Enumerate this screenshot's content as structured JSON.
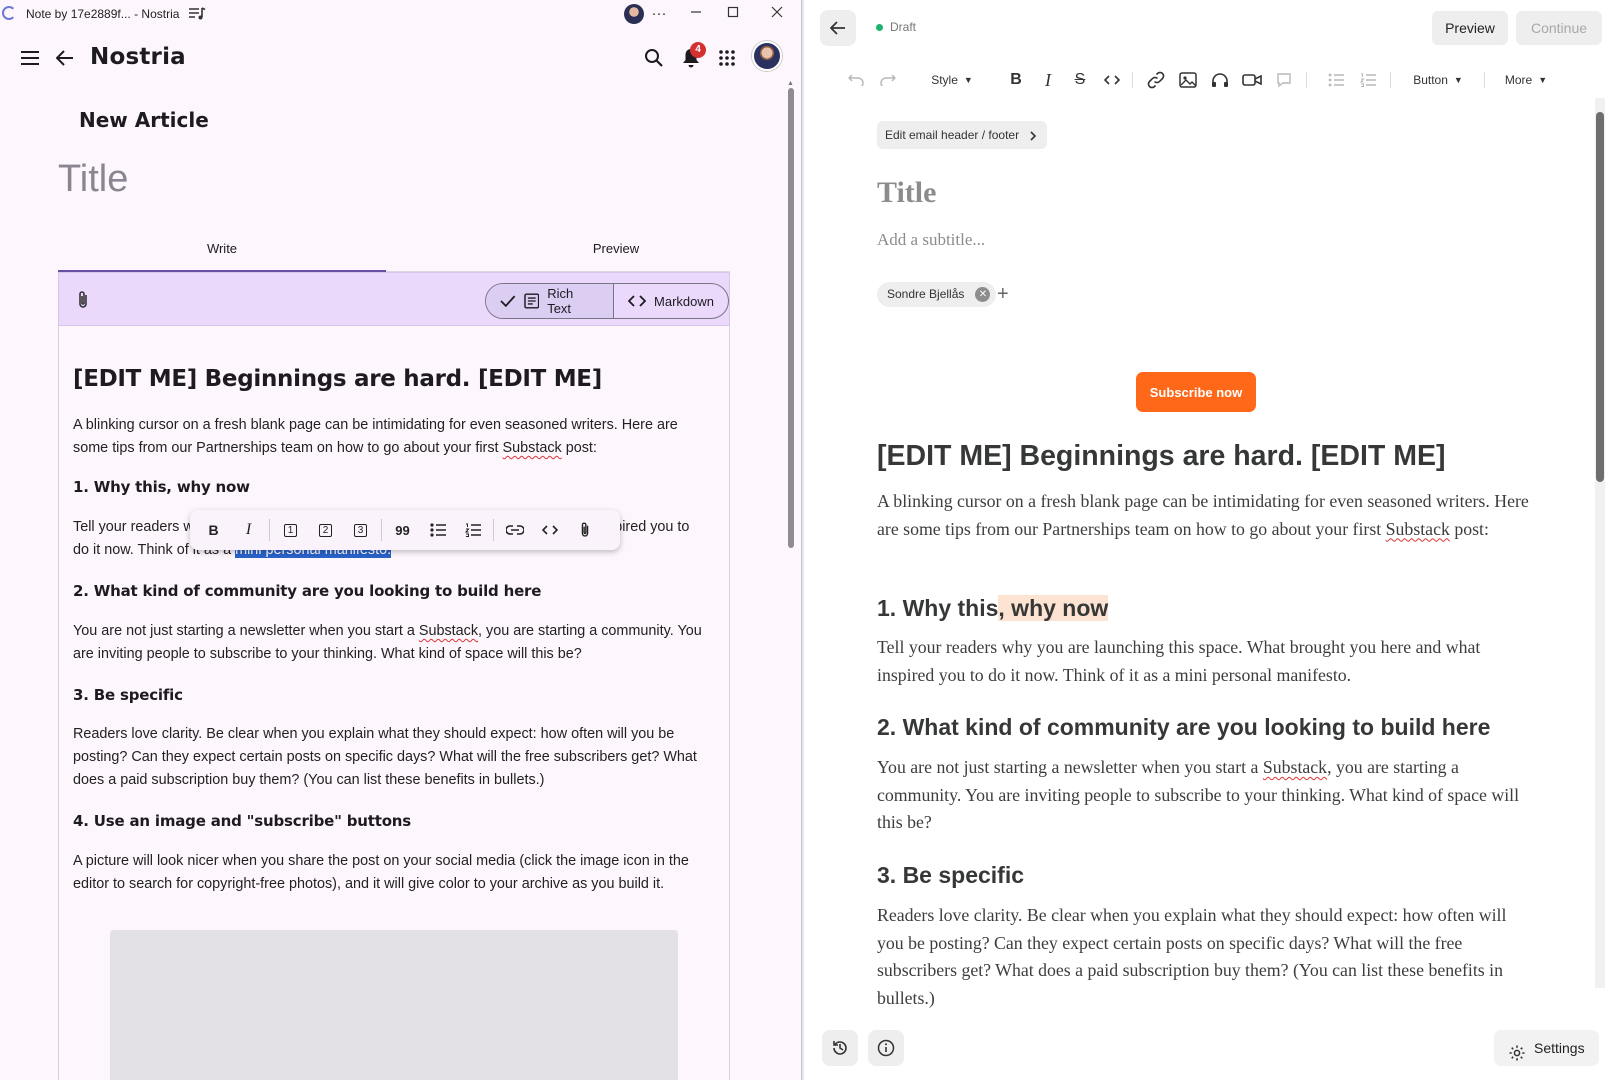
{
  "left_window": {
    "titlebar": {
      "title": "Note by 17e2889f... - Nostria"
    },
    "app": {
      "name": "Nostria",
      "notification_count": "4"
    },
    "page": {
      "heading": "New Article",
      "title_placeholder": "Title"
    },
    "tabs": [
      {
        "label": "Write",
        "active": true
      },
      {
        "label": "Preview",
        "active": false
      }
    ],
    "mode_toggle": {
      "rich_text": "Rich Text",
      "markdown": "Markdown",
      "selected": "Rich Text"
    },
    "article": {
      "h1": "[EDIT ME] Beginnings are hard. [EDIT ME]",
      "p1": "A blinking cursor on a fresh blank page can be intimidating for even seasoned writers. Here are some tips from our Partnerships team on how to go about your first ",
      "p1_word": "Substack",
      "p1_end": " post:",
      "h2_1": "1. Why this, why now",
      "p2_start": "Tell your readers w",
      "p2_end": "spired you to",
      "p2_line2": "do it now. Think of it as a ",
      "p2_selected": "mini personal manifesto.",
      "h2_2": "2. What kind of community are you looking to build here",
      "p3_a": "You are not just starting a newsletter when you start a ",
      "p3_word": "Substack",
      "p3_b": ", you are starting a community. You are inviting people to subscribe to your thinking. What kind of space will this be?",
      "h2_3": "3. Be specific",
      "p4": "Readers love clarity. Be clear when you explain what they should expect: how often will you be posting? Can they expect certain posts on specific days? What will the free subscribers get? What does a paid subscription buy them? (You can list these benefits in bullets.)",
      "h2_4": "4. Use an image and \"subscribe\" buttons",
      "p5": "A picture will look nicer when you share the post on your social media (click the image icon in the editor to search for copyright-free photos), and it will give color to your archive as you build it."
    },
    "floating_toolbar": {
      "h1": "1",
      "h2": "2",
      "h3": "3",
      "quote": "99"
    }
  },
  "right_window": {
    "status": "Draft",
    "buttons": {
      "preview": "Preview",
      "continue": "Continue",
      "settings": "Settings"
    },
    "toolbar": {
      "style": "Style",
      "button": "Button",
      "more": "More"
    },
    "edit_header_footer": "Edit email header / footer",
    "title_placeholder": "Title",
    "subtitle_placeholder": "Add a subtitle...",
    "author": "Sondre Bjellås",
    "subscribe_button": "Subscribe now",
    "article": {
      "h1": "[EDIT ME] Beginnings are hard. [EDIT ME]",
      "p1a": "A blinking cursor on a fresh blank page can be intimidating for even seasoned writers. Here are some tips from our Partnerships team on how to go about your first ",
      "p1_word": "Substack",
      "p1b": " post:",
      "h2_1a": "1. Why this",
      "h2_1b": ", why now",
      "p2": "Tell your readers why you are launching this space. What brought you here and what inspired you to do it now. Think of it as a mini personal manifesto.",
      "h2_2": "2. What kind of community are you looking to build here",
      "p3a": " You are not just starting a newsletter when you start a ",
      "p3_word": "Substack",
      "p3b": ", you are starting a community. You are inviting people to subscribe to your thinking. What kind of space will this be?",
      "h2_3": "3. Be specific",
      "p4": "Readers love clarity. Be clear when you explain what they should expect: how often will you be posting? Can they expect certain posts on specific days? What will the free subscribers get? What does a paid subscription buy them? (You can list these benefits in bullets.)"
    }
  },
  "colors": {
    "nostria_accent": "#6750a4",
    "substack_orange": "#ff6719",
    "selection": "#2a62c9",
    "draft_dot": "#1cb46b"
  }
}
